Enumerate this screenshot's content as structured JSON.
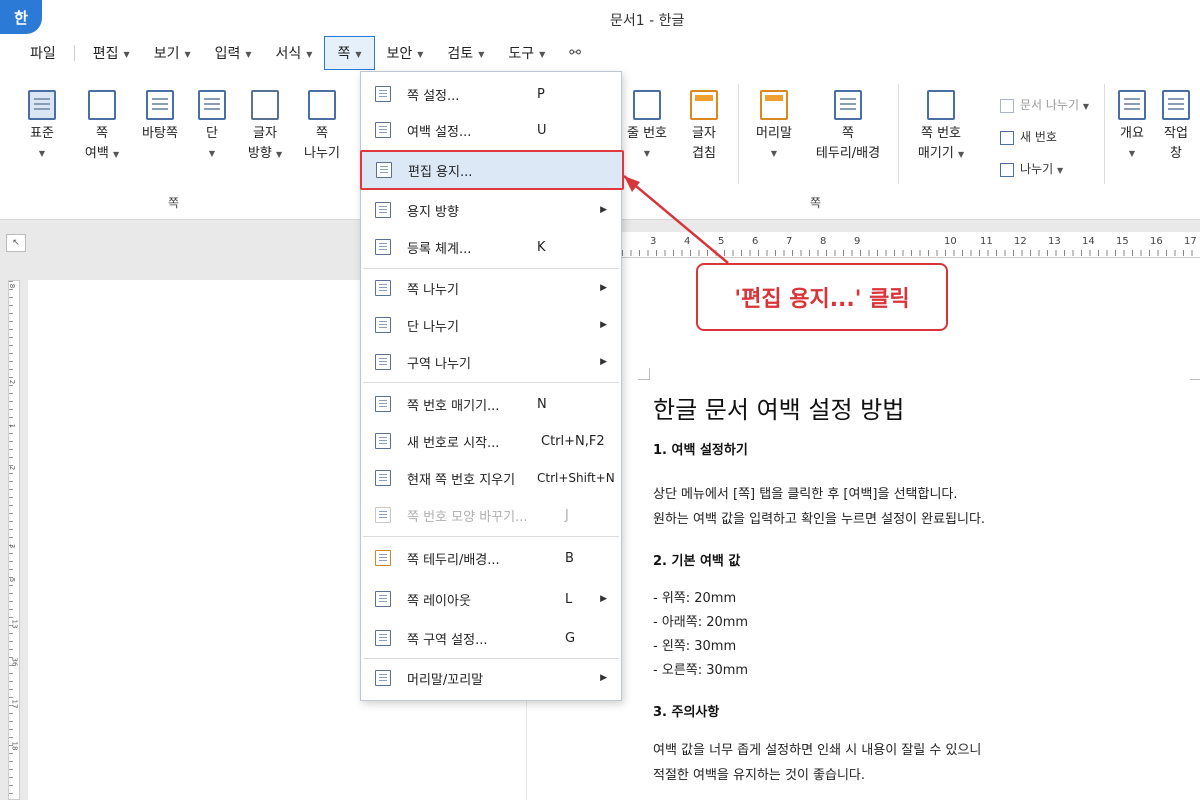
{
  "app": {
    "logo": "한",
    "title": "문서1 - 한글"
  },
  "menubar": {
    "items": [
      "파일",
      "편집",
      "보기",
      "입력",
      "서식",
      "쪽",
      "보안",
      "검토",
      "도구"
    ],
    "active": "쪽"
  },
  "ribbon": {
    "buttons": {
      "standard": "표준",
      "margin_1": "쪽",
      "margin_2": "여백",
      "background": "바탕쪽",
      "column": "단",
      "text_dir_1": "글자",
      "text_dir_2": "방향",
      "page_break_1": "쪽",
      "page_break_2": "나누기",
      "line_number": "줄 번호",
      "char_overlap_1": "글자",
      "char_overlap_2": "겹침",
      "header": "머리말",
      "border_1": "쪽",
      "border_2": "테두리/배경",
      "page_num_1": "쪽 번호",
      "page_num_2": "매기기",
      "doc_break": "문서 나누기",
      "new_number": "새 번호",
      "split": "나누기",
      "outline": "개요",
      "work_1": "작업",
      "work_2": "창"
    },
    "group_label_left": "쪽",
    "group_label_right": "쪽"
  },
  "dropdown": {
    "items": [
      {
        "label": "쪽 설정...",
        "key": "P"
      },
      {
        "label": "여백 설정...",
        "key": "U"
      },
      {
        "label": "편집 용지...",
        "key": ""
      },
      {
        "label": "용지 방향",
        "key": ""
      },
      {
        "label": "등록 체계...",
        "key": "K"
      },
      {
        "label": "쪽 나누기",
        "key": ""
      },
      {
        "label": "단 나누기",
        "key": ""
      },
      {
        "label": "구역 나누기",
        "key": ""
      },
      {
        "label": "쪽 번호 매기기...",
        "key": "N"
      },
      {
        "label": "새 번호로 시작...",
        "key": "Ctrl+N,F2"
      },
      {
        "label": "현재 쪽 번호 지우기",
        "key": "Ctrl+Shift+N"
      },
      {
        "label": "쪽 번호 모양 바꾸기...",
        "key": "J"
      },
      {
        "label": "쪽 테두리/배경...",
        "key": "B"
      },
      {
        "label": "쪽 레이아웃",
        "key": "L"
      },
      {
        "label": "쪽 구역 설정...",
        "key": "G"
      },
      {
        "label": "머리말/꼬리말",
        "key": ""
      }
    ]
  },
  "callout": {
    "text": "'편집 용지...' 클릭",
    "color": "#d9343a"
  },
  "ruler": {
    "h_numbers": [
      "3",
      "4",
      "5",
      "6",
      "7",
      "8",
      "9",
      "10",
      "11",
      "12",
      "13",
      "14",
      "15",
      "16",
      "17"
    ],
    "v_numbers": [
      "8",
      "2",
      "1",
      "2",
      "3",
      "5",
      "13",
      "36",
      "17",
      "18"
    ]
  },
  "document": {
    "title": "한글 문서 여백 설정 방법",
    "h1": "1. 여백 설정하기",
    "p1_line1": "상단 메뉴에서 [쪽] 탭을 클릭한 후 [여백]을 선택합니다.",
    "p1_line2": "원하는 여백 값을 입력하고 확인을 누르면 설정이 완료됩니다.",
    "h2": "2. 기본 여백 값",
    "list": [
      "- 위쪽: 20mm",
      "- 아래쪽: 20mm",
      "- 왼쪽: 30mm",
      "- 오른쪽: 30mm"
    ],
    "h3": "3. 주의사항",
    "p3_line1": "여백 값을 너무 좁게 설정하면 인쇄 시 내용이 잘릴 수 있으니",
    "p3_line2": "적절한 여백을 유지하는 것이 좋습니다."
  }
}
